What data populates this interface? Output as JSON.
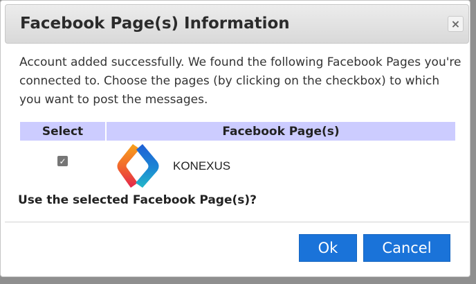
{
  "dialog": {
    "title": "Facebook Page(s) Information",
    "close_icon_glyph": "×",
    "message": "Account added successfully. We found the following Facebook Pages you're connected to. Choose the pages (by clicking on the checkbox) to which you want to post the messages.",
    "question": "Use the selected Facebook Page(s)?"
  },
  "table": {
    "headers": {
      "select": "Select",
      "pages": "Facebook Page(s)"
    },
    "header_color": "#ccccff",
    "rows": [
      {
        "checked": true,
        "checkmark_glyph": "✓",
        "logo_icon": "konexus-logo-icon",
        "page_name": "KONEXUS"
      }
    ]
  },
  "buttons": {
    "ok_label": "Ok",
    "cancel_label": "Cancel",
    "accent_color": "#1a73d9"
  }
}
